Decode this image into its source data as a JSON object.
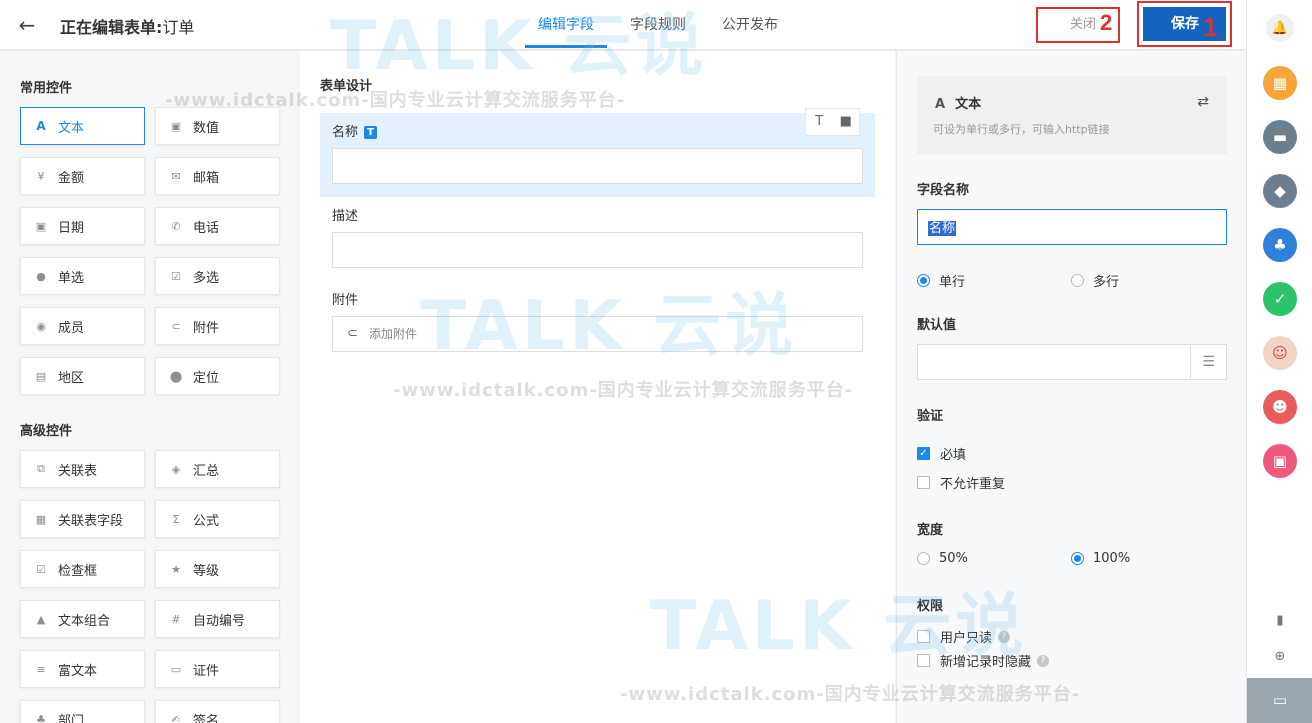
{
  "header": {
    "back_icon": "arrow-left-icon",
    "title_prefix": "正在编辑表单:",
    "title_name": "订单",
    "tabs": [
      {
        "label": "编辑字段",
        "active": true
      },
      {
        "label": "字段规则",
        "active": false
      },
      {
        "label": "公开发布",
        "active": false
      }
    ],
    "close_label": "关闭",
    "save_label": "保存",
    "annotation_close": "2",
    "annotation_save": "1"
  },
  "left": {
    "common_title": "常用控件",
    "common": [
      {
        "label": "文本",
        "icon": "A",
        "selected": true
      },
      {
        "label": "数值",
        "icon": "6"
      },
      {
        "label": "金额",
        "icon": "¥"
      },
      {
        "label": "邮箱",
        "icon": "✉"
      },
      {
        "label": "日期",
        "icon": "▣"
      },
      {
        "label": "电话",
        "icon": "✆"
      },
      {
        "label": "单选",
        "icon": "●"
      },
      {
        "label": "多选",
        "icon": "☑"
      },
      {
        "label": "成员",
        "icon": "◉"
      },
      {
        "label": "附件",
        "icon": "⊂"
      },
      {
        "label": "地区",
        "icon": "▤"
      },
      {
        "label": "定位",
        "icon": "⬤"
      }
    ],
    "advanced_title": "高级控件",
    "advanced": [
      {
        "label": "关联表",
        "icon": "⧉"
      },
      {
        "label": "汇总",
        "icon": "◈"
      },
      {
        "label": "关联表字段",
        "icon": "▦"
      },
      {
        "label": "公式",
        "icon": "Σ"
      },
      {
        "label": "检查框",
        "icon": "☑"
      },
      {
        "label": "等级",
        "icon": "★"
      },
      {
        "label": "文本组合",
        "icon": "▲"
      },
      {
        "label": "自动编号",
        "icon": "#"
      },
      {
        "label": "富文本",
        "icon": "≡"
      },
      {
        "label": "证件",
        "icon": "▭"
      },
      {
        "label": "部门",
        "icon": "♣"
      },
      {
        "label": "签名",
        "icon": "✍"
      }
    ]
  },
  "main": {
    "title": "表单设计",
    "fields": [
      {
        "label": "名称",
        "badge": "T"
      },
      {
        "label": "描述"
      },
      {
        "label": "附件",
        "placeholder": "添加附件"
      }
    ],
    "tool_t": "T",
    "tool_delete": "🗑"
  },
  "right": {
    "card_letter": "A",
    "card_title": "文本",
    "card_desc": "可设为单行或多行，可输入http链接",
    "field_name_label": "字段名称",
    "field_name_value": "名称",
    "single_line": "单行",
    "multi_line": "多行",
    "default_label": "默认值",
    "validation_label": "验证",
    "required": "必填",
    "no_duplicate": "不允许重复",
    "width_label": "宽度",
    "width_50": "50%",
    "width_100": "100%",
    "permission_label": "权限",
    "readonly": "用户只读",
    "hide_on_new": "新增记录时隐藏"
  },
  "watermark": {
    "text": "-www.idctalk.com-国内专业云计算交流服务平台-",
    "brand": "TALK 云说"
  },
  "colors": {
    "accent": "#1e88e5",
    "save": "#1565c0",
    "annotation": "#e02f2f"
  }
}
